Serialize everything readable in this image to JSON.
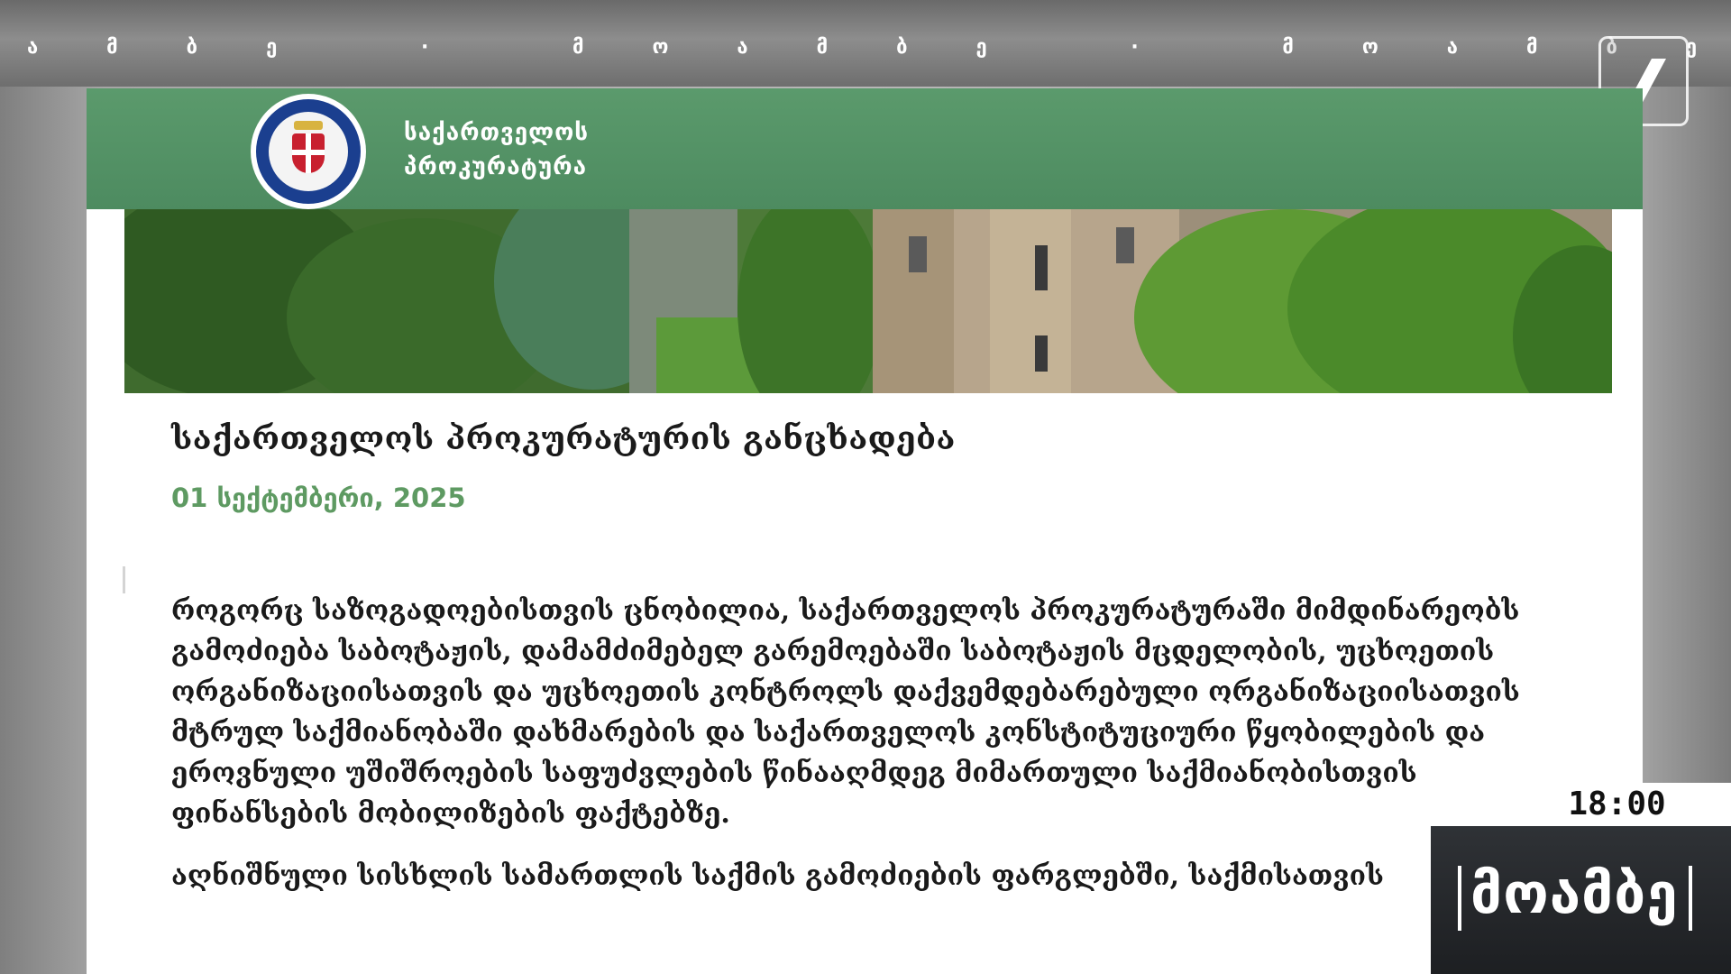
{
  "ticker": {
    "text": "ამბე · მოამბე · მოამბე · მ"
  },
  "channel_logo": {
    "icon": "first-channel-logo-icon"
  },
  "site": {
    "name_line1": "საქართველოს",
    "name_line2": "პროკურატურა",
    "emblem_icon": "prosecution-service-emblem-icon"
  },
  "article": {
    "title": "საქართველოს პროკურატურის განცხადება",
    "date": "01 სექტემბერი, 2025",
    "paragraph1": "როგორც საზოგადოებისთვის ცნობილია, საქართველოს პროკურატურაში მიმდინარეობს გამოძიება საბოტაჟის, დამამძიმებელ გარემოებაში საბოტაჟის მცდელობის, უცხოეთის ორგანიზაციისათვის და უცხოეთის კონტროლს დაქვემდებარებული ორგანიზაციისათვის მტრულ საქმიანობაში დახმარების და საქართველოს კონსტიტუციური წყობილების და ეროვნული უშიშროების საფუძვლების წინააღმდეგ მიმართული საქმიანობისთვის ფინანსების მობილიზების ფაქტებზე.",
    "paragraph2": "აღნიშნული სისხლის სამართლის საქმის გამოძიების ფარგლებში, საქმისათვის"
  },
  "broadcast": {
    "time": "18:00",
    "program": "მოამბე"
  },
  "colors": {
    "header_green": "#4d8b60",
    "date_green": "#5e9a62",
    "program_bg": "#1d1f22"
  }
}
